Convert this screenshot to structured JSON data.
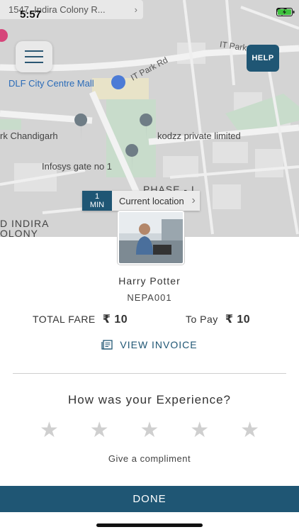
{
  "status": {
    "time": "5:57"
  },
  "map": {
    "address_pill": "1547, Indira Colony R...",
    "labels": {
      "it_park_rd_1": "IT Park Rd",
      "it_park_rd_2": "IT Park",
      "dlf": "DLF City Centre Mall",
      "park": "rk Chandigarh",
      "kodzz": "kodzz private limited",
      "infosys": "Infosys gate no 1",
      "phase": "PHASE - I",
      "indira": "D INDIRA",
      "colony": "OLONY"
    },
    "help_label": "HELP",
    "eta_value": "1",
    "eta_unit": "MIN",
    "current_location": "Current location"
  },
  "driver": {
    "name": "Harry Potter",
    "vehicle_id": "NEPA001"
  },
  "fare": {
    "total_label": "TOTAL FARE",
    "total_amount": "₹ 10",
    "to_pay_label": "To Pay",
    "to_pay_amount": "₹ 10"
  },
  "invoice": {
    "label": "VIEW INVOICE"
  },
  "rating": {
    "title": "How was your Experience?",
    "stars": 0,
    "max_stars": 5,
    "compliment": "Give a compliment"
  },
  "done_label": "DONE",
  "colors": {
    "primary": "#1f5674",
    "star_empty": "#cfcfcf"
  }
}
